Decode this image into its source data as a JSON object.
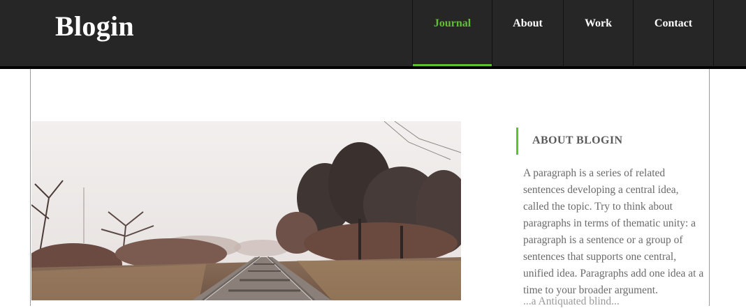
{
  "header": {
    "logo": "Blogin",
    "nav": [
      {
        "label": "Journal",
        "active": true
      },
      {
        "label": "About"
      },
      {
        "label": "Work"
      },
      {
        "label": "Contact"
      }
    ]
  },
  "colors": {
    "header_bg": "#262626",
    "accent": "#5ec22f",
    "text": "#6a6a6a"
  },
  "hero": {
    "image": "landscape-photo-railway-track-with-bare-trees"
  },
  "sidebar": {
    "widget_title": "ABOUT BLOGIN",
    "widget_text": "A paragraph is a series of related sentences developing a central idea, called the topic. Try to think about paragraphs in terms of thematic unity: a paragraph is a sentence or a group of sentences that supports one central, unified idea. Paragraphs add one idea at a time to your broader argument.",
    "widget_text_cutoff": "...a Antiquated blind..."
  }
}
